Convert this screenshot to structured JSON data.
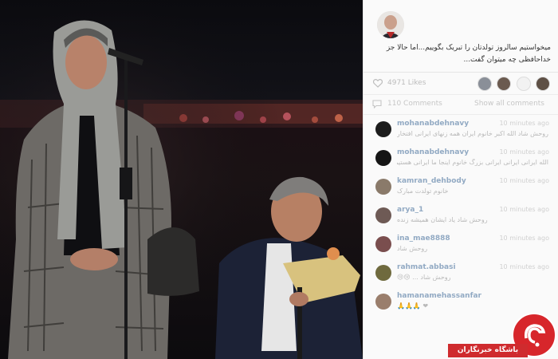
{
  "post": {
    "caption": "میخواستیم سالروز تولدتان را تبریک بگوییم...اما حالا جز خداحافظی چه میتوان گفت...",
    "likes_text": "4971 Likes",
    "comments_count_text": "110 Comments",
    "show_all_label": "Show all comments"
  },
  "comments": [
    {
      "user": "mohanabdehnavy",
      "time": "10 minutes ago",
      "text": "روحش شاد الله اکبر خانوم ایران همه زنهای ایرانی افتخار"
    },
    {
      "user": "mohanabdehnavy",
      "time": "10 minutes ago",
      "text": "الله ایرانی ایرانی ایرانی بزرگ خانوم اینجا ما ایرانی هستیم"
    },
    {
      "user": "kamran_dehbody",
      "time": "10 minutes ago",
      "text": "خانوم تولدت مبارک"
    },
    {
      "user": "arya_1",
      "time": "10 minutes ago",
      "text": "روحش شاد یاد ایشان همیشه زنده"
    },
    {
      "user": "ina_mae8888",
      "time": "10 minutes ago",
      "text": "روحش شاد"
    },
    {
      "user": "rahmat.abbasi",
      "time": "10 minutes ago",
      "text": "روحش شاد ... 😢😢"
    },
    {
      "user": "hamanamehassanfar",
      "time": "",
      "text": "🙏🙏🙏 ❤"
    }
  ],
  "watermark": {
    "label": "باشگاه خبرنگاران"
  }
}
